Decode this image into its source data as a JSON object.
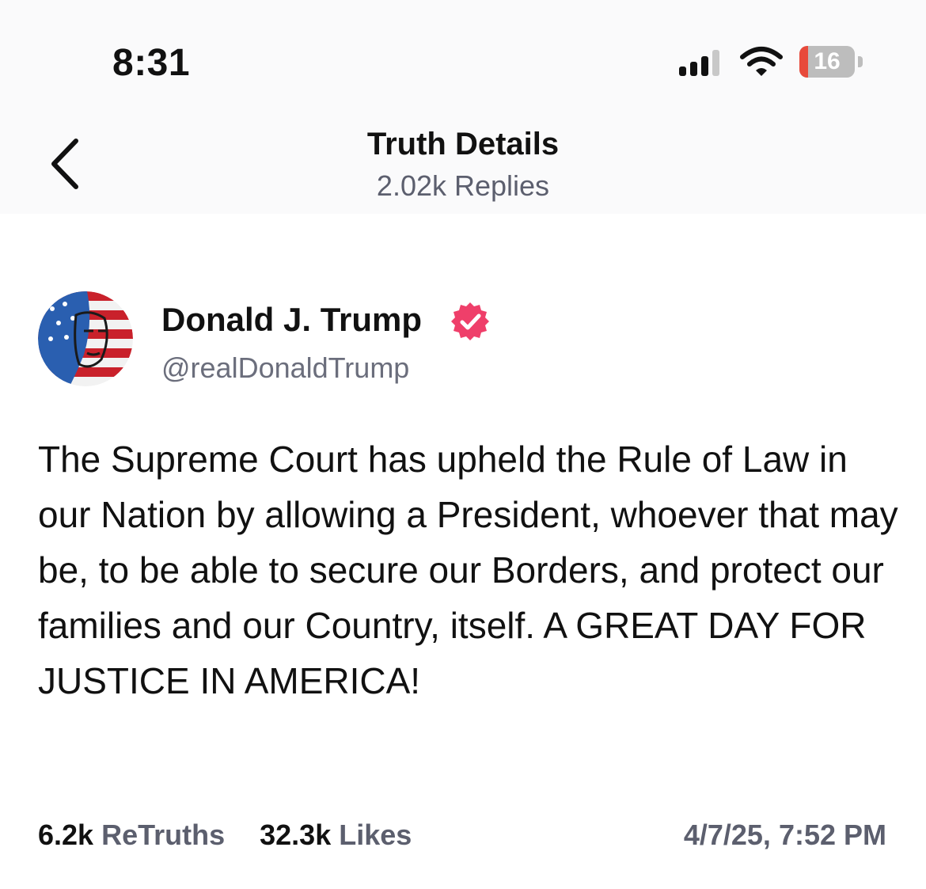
{
  "status_bar": {
    "time": "8:31",
    "battery_level": "16",
    "battery_fraction": 0.16,
    "signal_bars_filled": 3,
    "signal_bars_total": 4,
    "icons": [
      "signal-icon",
      "wifi-icon",
      "battery-icon"
    ]
  },
  "header": {
    "title": "Truth Details",
    "subtitle": "2.02k Replies",
    "back_icon": "chevron-left-icon"
  },
  "post": {
    "author_name": "Donald J. Trump",
    "verified_icon": "verified-badge-icon",
    "handle": "@realDonaldTrump",
    "avatar_icon": "flag-portrait-avatar",
    "body": "The Supreme Court has upheld the Rule of Law in our Nation by allowing a President, whoever that may be, to be able to secure our Borders, and protect our families and our Country, itself. A GREAT DAY FOR JUSTICE IN AMERICA!",
    "retruths_count": "6.2k",
    "retruths_label": "ReTruths",
    "likes_count": "32.3k",
    "likes_label": "Likes",
    "timestamp": "4/7/25, 7:52 PM"
  },
  "colors": {
    "accent_verified": "#ef3f6a",
    "battery_low": "#e84a3b",
    "muted_text": "#5c5f6e"
  }
}
